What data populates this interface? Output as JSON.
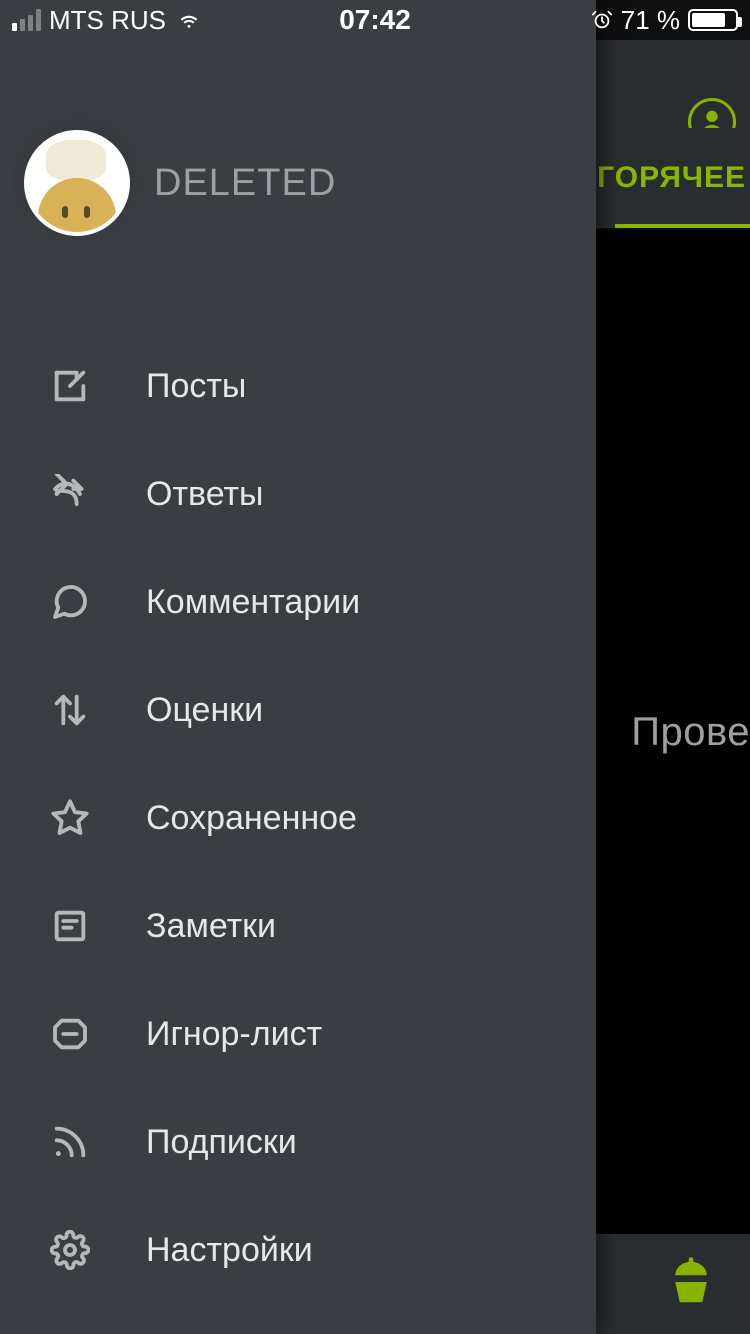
{
  "status_bar": {
    "carrier": "MTS RUS",
    "time": "07:42",
    "battery_pct": "71 %"
  },
  "background": {
    "tab_active": "ГОРЯЧЕЕ",
    "content_hint": "Прове"
  },
  "drawer": {
    "username": "DELETED",
    "menu": [
      {
        "label": "Посты"
      },
      {
        "label": "Ответы"
      },
      {
        "label": "Комментарии"
      },
      {
        "label": "Оценки"
      },
      {
        "label": "Сохраненное"
      },
      {
        "label": "Заметки"
      },
      {
        "label": "Игнор-лист"
      },
      {
        "label": "Подписки"
      },
      {
        "label": "Настройки"
      }
    ]
  }
}
